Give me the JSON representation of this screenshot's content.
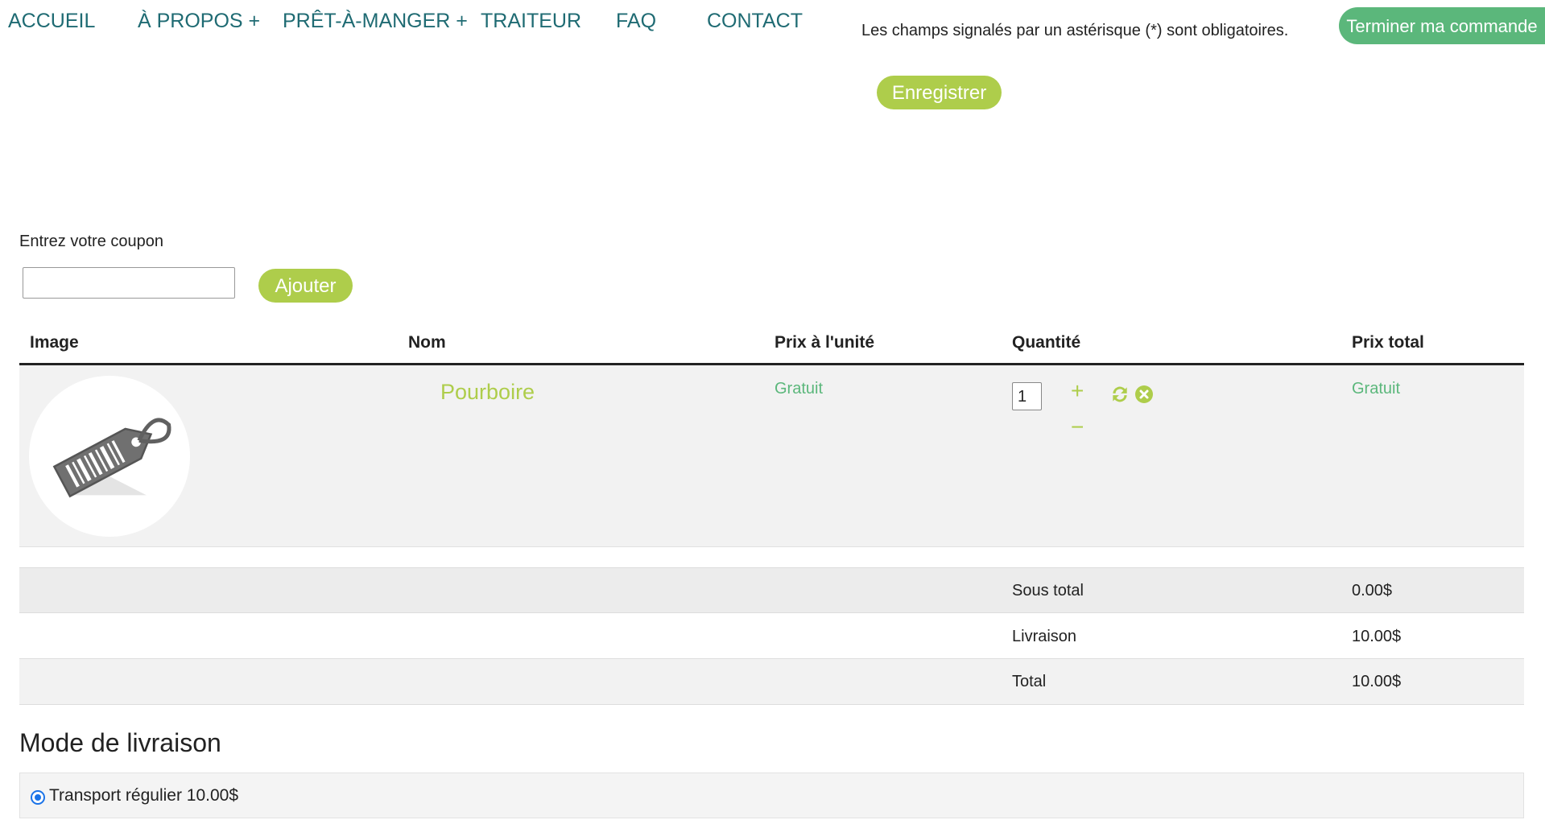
{
  "nav": {
    "items": [
      "ACCUEIL",
      "À PROPOS +",
      "PRÊT-À-MANGER +",
      "TRAITEUR",
      "FAQ",
      "CONTACT"
    ]
  },
  "header": {
    "required_message": "Les champs signalés par un astérisque (*) sont obligatoires.",
    "finish_order": "Terminer ma commande",
    "save": "Enregistrer"
  },
  "coupon": {
    "label": "Entrez votre coupon",
    "value": "",
    "add": "Ajouter"
  },
  "table": {
    "headers": [
      "Image",
      "Nom",
      "Prix à l'unité",
      "Quantité",
      "Prix total"
    ],
    "items": [
      {
        "name": "Pourboire",
        "unit_price": "Gratuit",
        "quantity": "1",
        "total": "Gratuit",
        "image_icon": "price-tag-icon"
      }
    ],
    "plus": "+",
    "minus": "−"
  },
  "totals": [
    {
      "label": "Sous total",
      "value": "0.00$"
    },
    {
      "label": "Livraison",
      "value": "10.00$"
    },
    {
      "label": "Total",
      "value": "10.00$"
    }
  ],
  "shipping": {
    "title": "Mode de livraison",
    "options": [
      {
        "label": "Transport régulier 10.00$",
        "selected": true
      }
    ]
  },
  "colors": {
    "nav": "#1f6b73",
    "green": "#5bb77b",
    "lime": "#aecd4b"
  }
}
